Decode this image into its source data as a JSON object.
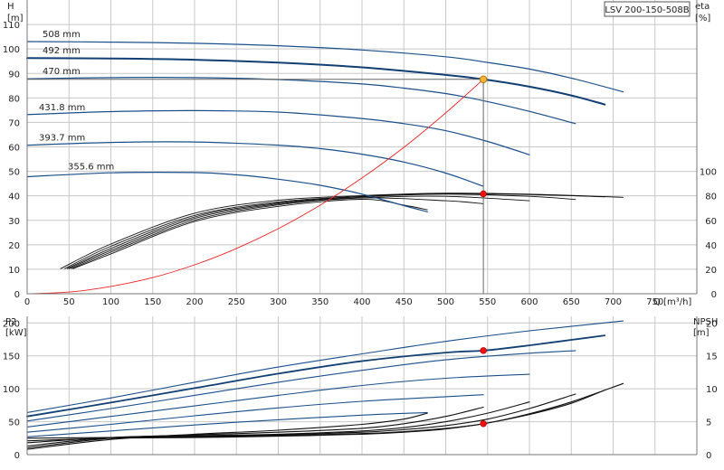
{
  "model_label": "LSV 200-150-508B",
  "colors": {
    "blue": "#1a4f8c",
    "blue_bold": "#123f73",
    "black": "#111111",
    "system_curve": "#ee2222",
    "marker_fill": "#f5b335",
    "marker_red": "#ee1111",
    "grid": "#c8c8c8"
  },
  "chart_data": [
    {
      "type": "line",
      "panel": "head",
      "y_label_left": [
        "H",
        "[m]"
      ],
      "y_label_right": [
        "eta",
        "[%]"
      ],
      "x_label": "Q [m³/h]",
      "xlim": [
        0,
        800
      ],
      "ylim": [
        0,
        120
      ],
      "x_ticks": [
        0,
        50,
        100,
        150,
        200,
        250,
        300,
        350,
        400,
        450,
        500,
        550,
        600,
        650,
        700,
        750
      ],
      "y_ticks": [
        0,
        10,
        20,
        30,
        40,
        50,
        60,
        70,
        80,
        90,
        100,
        110
      ],
      "eta_ticks": [
        0,
        20,
        40,
        60,
        80,
        100
      ],
      "eta_scale": "eta 0-100 % plotted on H 0-50 m",
      "head_curves": [
        {
          "name": "508 mm",
          "x": [
            0,
            100,
            200,
            300,
            400,
            500,
            550,
            600,
            650,
            712
          ],
          "y": [
            103,
            102.8,
            102.3,
            101.3,
            99.6,
            96.8,
            94.5,
            91.8,
            88.1,
            82.5
          ]
        },
        {
          "name": "492 mm",
          "x": [
            0,
            100,
            200,
            300,
            400,
            500,
            545,
            600,
            650,
            690
          ],
          "y": [
            96.3,
            96.1,
            95.6,
            94.4,
            92.5,
            89.4,
            87.6,
            84.6,
            81,
            77.3
          ],
          "bold": true
        },
        {
          "name": "470 mm",
          "x": [
            0,
            100,
            200,
            300,
            400,
            450,
            500,
            550,
            600,
            655
          ],
          "y": [
            87.8,
            88.3,
            88.3,
            87.5,
            85.7,
            84,
            81.8,
            78.5,
            74.5,
            69.5
          ]
        },
        {
          "name": "431.8 mm",
          "x": [
            0,
            100,
            200,
            300,
            400,
            450,
            500,
            550,
            600
          ],
          "y": [
            73.2,
            74.4,
            74.8,
            74.2,
            71.6,
            69.5,
            66.6,
            62.2,
            56.8
          ]
        },
        {
          "name": "393.7 mm",
          "x": [
            0,
            100,
            200,
            300,
            350,
            400,
            450,
            500,
            545
          ],
          "y": [
            60.7,
            61.8,
            62,
            60.7,
            59.3,
            57,
            53.8,
            49.3,
            43.9
          ]
        },
        {
          "name": "355.6 mm",
          "x": [
            0,
            100,
            200,
            250,
            300,
            350,
            400,
            450,
            478
          ],
          "y": [
            47.8,
            49.4,
            49.5,
            48.6,
            46.8,
            44.3,
            40.7,
            36,
            33.5
          ]
        }
      ],
      "efficiency_curves": [
        {
          "x": [
            40,
            100,
            200,
            300,
            400,
            500,
            600,
            712
          ],
          "y": [
            20.5,
            40.6,
            65.8,
            76.4,
            80.2,
            82.2,
            81.4,
            78.8
          ]
        },
        {
          "x": [
            45,
            100,
            200,
            300,
            400,
            500,
            600,
            690
          ],
          "y": [
            20.5,
            38.8,
            64,
            75,
            79.6,
            81.8,
            81,
            79.2
          ]
        },
        {
          "x": [
            48,
            100,
            200,
            300,
            400,
            500,
            600,
            655
          ],
          "y": [
            20.5,
            37,
            62.8,
            74.2,
            79.2,
            81.4,
            79.6,
            77
          ]
        },
        {
          "x": [
            50,
            100,
            200,
            300,
            400,
            500,
            600
          ],
          "y": [
            20.5,
            35.4,
            61.6,
            73.4,
            78.4,
            79.6,
            76
          ]
        },
        {
          "x": [
            53,
            100,
            200,
            300,
            400,
            500,
            545
          ],
          "y": [
            20.5,
            34,
            60.2,
            72.6,
            78.2,
            76,
            73.6
          ]
        },
        {
          "x": [
            55,
            100,
            200,
            300,
            400,
            450,
            478
          ],
          "y": [
            20.5,
            32.6,
            59,
            71.4,
            77.2,
            72.4,
            68.6
          ]
        }
      ],
      "system_curve": {
        "x": [
          0,
          50,
          100,
          150,
          200,
          250,
          300,
          350,
          400,
          450,
          500,
          545
        ],
        "y": [
          0,
          0.7,
          3,
          6.6,
          11.8,
          18.5,
          26.6,
          36.2,
          47.3,
          59.8,
          73.9,
          87.6
        ]
      },
      "duty_point": {
        "x": 545,
        "y": 87.6
      },
      "efficiency_point": {
        "x": 545,
        "y": 81.6
      }
    },
    {
      "type": "line",
      "panel": "power_npsh",
      "y_label_left": [
        "P2",
        "[kW]"
      ],
      "y_label_right": [
        "NPSH",
        "[m]"
      ],
      "xlim": [
        0,
        800
      ],
      "ylim": [
        0,
        210
      ],
      "y_ticks": [
        0,
        50,
        100,
        150,
        200
      ],
      "npsh_ticks": [
        0,
        5,
        10,
        15,
        20
      ],
      "npsh_scale": "NPSH 0-21 m plotted on P2 0-210 kW",
      "power_curves": [
        {
          "x": [
            0,
            100,
            200,
            300,
            400,
            500,
            600,
            712
          ],
          "y": [
            64,
            86,
            110,
            133,
            153,
            172,
            188,
            203
          ]
        },
        {
          "x": [
            0,
            100,
            200,
            300,
            400,
            500,
            545,
            600,
            690
          ],
          "y": [
            58,
            79,
            101,
            123,
            142,
            155,
            158,
            166,
            181
          ],
          "bold": true
        },
        {
          "x": [
            0,
            100,
            200,
            300,
            400,
            500,
            600,
            655
          ],
          "y": [
            51,
            70,
            90,
            110,
            128,
            144,
            154,
            158
          ]
        },
        {
          "x": [
            0,
            100,
            200,
            300,
            400,
            500,
            600
          ],
          "y": [
            42,
            58,
            74,
            90,
            105,
            116,
            122
          ]
        },
        {
          "x": [
            0,
            100,
            200,
            300,
            400,
            500,
            545
          ],
          "y": [
            34,
            46,
            59,
            71,
            81,
            88,
            91
          ]
        },
        {
          "x": [
            0,
            100,
            200,
            300,
            400,
            478
          ],
          "y": [
            27,
            36,
            45,
            53,
            60,
            64
          ]
        }
      ],
      "npsh_curves": [
        {
          "x": [
            0,
            100,
            200,
            300,
            400,
            450,
            500,
            550,
            600,
            650,
            712
          ],
          "y": [
            2.1,
            2.5,
            2.6,
            2.8,
            3.1,
            3.4,
            3.9,
            4.8,
            6.2,
            8.0,
            10.8
          ]
        },
        {
          "x": [
            0,
            100,
            200,
            300,
            400,
            450,
            500,
            545,
            600,
            650,
            690
          ],
          "y": [
            2.5,
            2.6,
            2.7,
            2.9,
            3.2,
            3.5,
            4.0,
            4.7,
            6.1,
            7.8,
            9.8
          ]
        },
        {
          "x": [
            0,
            100,
            200,
            300,
            400,
            450,
            500,
            550,
            600,
            655
          ],
          "y": [
            1.8,
            2.6,
            2.8,
            3.0,
            3.4,
            3.8,
            4.4,
            5.4,
            7.0,
            9.2
          ]
        },
        {
          "x": [
            0,
            100,
            200,
            300,
            400,
            450,
            500,
            550,
            600
          ],
          "y": [
            1.3,
            2.6,
            2.9,
            3.1,
            3.6,
            4.1,
            5.0,
            6.3,
            8.0
          ]
        },
        {
          "x": [
            0,
            100,
            200,
            300,
            400,
            450,
            500,
            545
          ],
          "y": [
            1.0,
            2.5,
            3.0,
            3.4,
            4.0,
            4.7,
            5.8,
            7.2
          ]
        },
        {
          "x": [
            0,
            100,
            200,
            300,
            400,
            450,
            478
          ],
          "y": [
            0.8,
            2.3,
            3.1,
            3.7,
            4.6,
            5.4,
            6.3
          ]
        }
      ],
      "power_point": {
        "x": 545,
        "y": 158
      },
      "npsh_point": {
        "x": 545,
        "y": 4.7
      }
    }
  ]
}
